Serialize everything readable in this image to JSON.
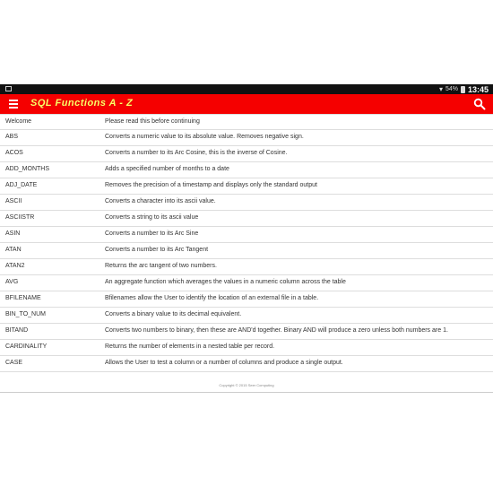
{
  "status": {
    "battery_pct": "54%",
    "time": "13:45"
  },
  "appbar": {
    "title": "SQL Functions A - Z",
    "menu_icon": "menu-icon",
    "search_icon": "search-icon",
    "color": "#f50000",
    "title_color": "#ffff66"
  },
  "rows": [
    {
      "name": "Welcome",
      "desc": "Please read this before continuing"
    },
    {
      "name": "ABS",
      "desc": "Converts a numeric value to its absolute value. Removes negative sign."
    },
    {
      "name": "ACOS",
      "desc": "Converts a number to its Arc Cosine, this is the inverse of Cosine."
    },
    {
      "name": "ADD_MONTHS",
      "desc": "Adds a specified number of months to a date"
    },
    {
      "name": "ADJ_DATE",
      "desc": "Removes the precision of a timestamp and displays only the standard output"
    },
    {
      "name": "ASCII",
      "desc": "Converts a character into its ascii value."
    },
    {
      "name": "ASCIISTR",
      "desc": "Converts a string to its ascii value"
    },
    {
      "name": "ASIN",
      "desc": "Converts a number to its Arc Sine"
    },
    {
      "name": "ATAN",
      "desc": "Converts a number to its Arc Tangent"
    },
    {
      "name": "ATAN2",
      "desc": "Returns the arc tangent of two numbers."
    },
    {
      "name": "AVG",
      "desc": "An aggregate function which averages the values in a numeric column across the table"
    },
    {
      "name": "BFILENAME",
      "desc": "Bfilenames allow the User to identify the location of an external file in a table."
    },
    {
      "name": "BIN_TO_NUM",
      "desc": "Converts a binary value to its decimal equivalent."
    },
    {
      "name": "BITAND",
      "desc": "Converts two numbers to binary, then these are AND'd together. Binary AND will produce a zero unless both numbers are 1."
    },
    {
      "name": "CARDINALITY",
      "desc": "Returns the number of elements in a nested table per record."
    },
    {
      "name": "CASE",
      "desc": "Allows the User to test a column or a number of columns and produce a single output."
    }
  ],
  "footer": "Copyright © 2015 Seer Computing"
}
